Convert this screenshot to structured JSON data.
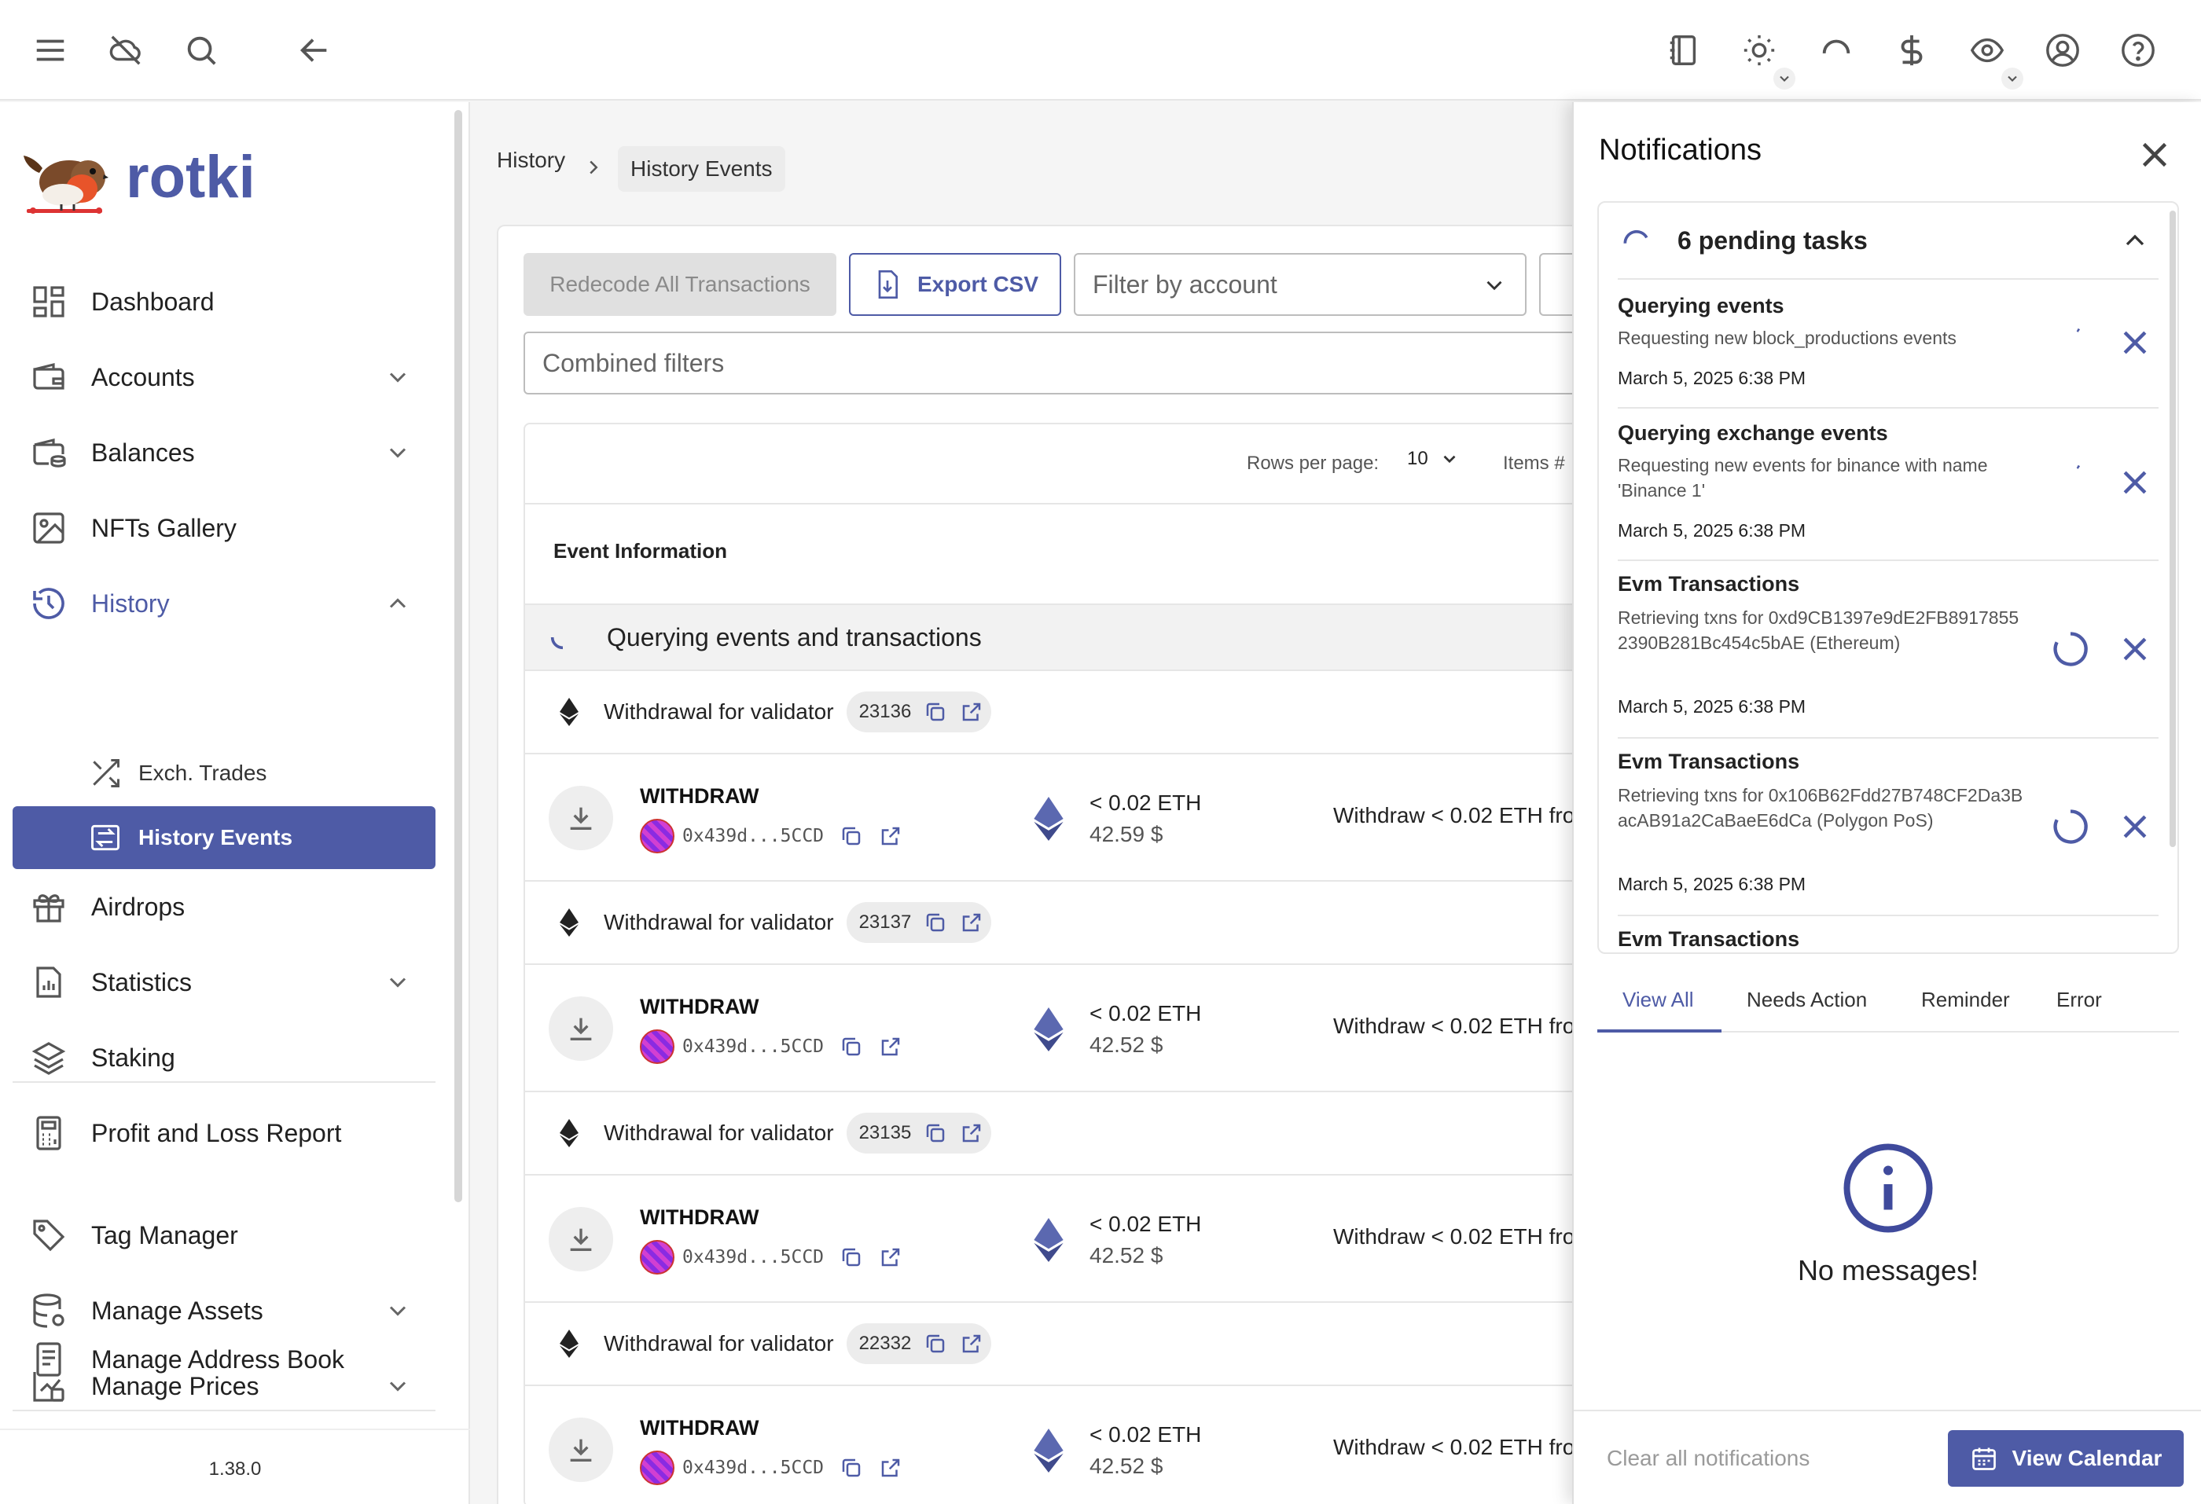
{
  "topbar": {
    "left_icons": [
      "menu-icon",
      "cloud-off-icon",
      "search-icon",
      "back-arrow-icon"
    ],
    "right_icons": [
      "notebook-icon",
      "theme-sun-icon",
      "loading-icon",
      "currency-dollar-icon",
      "eye-icon",
      "account-circle-icon",
      "help-icon"
    ]
  },
  "sidebar": {
    "brand": "rotki",
    "items": [
      {
        "label": "Dashboard",
        "icon": "dashboard-icon"
      },
      {
        "label": "Accounts",
        "icon": "wallet-icon",
        "expandable": true
      },
      {
        "label": "Balances",
        "icon": "balances-icon",
        "expandable": true
      },
      {
        "label": "NFTs Gallery",
        "icon": "image-icon"
      },
      {
        "label": "History",
        "icon": "history-icon",
        "expandable": true,
        "expanded": true
      },
      {
        "label": "Airdrops",
        "icon": "gift-icon"
      },
      {
        "label": "Statistics",
        "icon": "statistics-icon",
        "expandable": true
      },
      {
        "label": "Staking",
        "icon": "layers-icon"
      },
      {
        "label": "Profit and Loss Report",
        "icon": "calculator-icon"
      },
      {
        "label": "Tag Manager",
        "icon": "tag-icon"
      },
      {
        "label": "Manage Assets",
        "icon": "database-icon",
        "expandable": true
      },
      {
        "label": "Manage Prices",
        "icon": "price-chart-icon",
        "expandable": true
      },
      {
        "label": "Manage Address Book",
        "icon": "address-book-icon"
      }
    ],
    "sub_items": [
      {
        "label": "Exch. Trades",
        "icon": "shuffle-icon"
      },
      {
        "label": "History Events",
        "icon": "exchange-icon",
        "selected": true
      }
    ],
    "version": "1.38.0"
  },
  "breadcrumb": {
    "parent": "History",
    "current": "History Events"
  },
  "toolbar": {
    "redecode_label": "Redecode All Transactions",
    "export_label": "Export CSV",
    "account_filter_placeholder": "Filter by account",
    "combined_filters_placeholder": "Combined filters"
  },
  "table": {
    "rows_per_page_label": "Rows per page:",
    "rows_per_page_value": "10",
    "items_label": "Items #",
    "header": "Event Information",
    "querying_label": "Querying events and transactions",
    "groups": [
      {
        "title": "Withdrawal for validator",
        "validator": "23136",
        "event": {
          "type": "WITHDRAW",
          "address": "0x439d...5CCD",
          "amount": "< 0.02 ETH",
          "usd": "42.59 $",
          "description": "Withdraw < 0.02 ETH fro"
        }
      },
      {
        "title": "Withdrawal for validator",
        "validator": "23137",
        "event": {
          "type": "WITHDRAW",
          "address": "0x439d...5CCD",
          "amount": "< 0.02 ETH",
          "usd": "42.52 $",
          "description": "Withdraw < 0.02 ETH fro"
        }
      },
      {
        "title": "Withdrawal for validator",
        "validator": "23135",
        "event": {
          "type": "WITHDRAW",
          "address": "0x439d...5CCD",
          "amount": "< 0.02 ETH",
          "usd": "42.52 $",
          "description": "Withdraw < 0.02 ETH fro"
        }
      },
      {
        "title": "Withdrawal for validator",
        "validator": "22332",
        "event": {
          "type": "WITHDRAW",
          "address": "0x439d...5CCD",
          "amount": "< 0.02 ETH",
          "usd": "42.52 $",
          "description": "Withdraw < 0.02 ETH fro"
        }
      }
    ]
  },
  "notifications": {
    "title": "Notifications",
    "pending_label": "6 pending tasks",
    "tasks": [
      {
        "title": "Querying events",
        "description": "Requesting new block_productions events",
        "time": "March 5, 2025 6:38 PM"
      },
      {
        "title": "Querying exchange events",
        "description": "Requesting new events for binance with name 'Binance 1'",
        "time": "March 5, 2025 6:38 PM"
      },
      {
        "title": "Evm Transactions",
        "description": "Retrieving txns for 0xd9CB1397e9dE2FB89178552390B281Bc454c5bAE (Ethereum)",
        "time": "March 5, 2025 6:38 PM"
      },
      {
        "title": "Evm Transactions",
        "description": "Retrieving txns for 0x106B62Fdd27B748CF2Da3BacAB91a2CaBaeE6dCa (Polygon PoS)",
        "time": "March 5, 2025 6:38 PM"
      },
      {
        "title": "Evm Transactions",
        "description": "",
        "time": ""
      }
    ],
    "tabs": [
      "View All",
      "Needs Action",
      "Reminder",
      "Error"
    ],
    "empty_message": "No messages!",
    "clear_all_label": "Clear all notifications",
    "view_calendar_label": "View Calendar"
  },
  "colors": {
    "accent": "#4e5ba6",
    "disabled_bg": "#e0e0e0"
  }
}
